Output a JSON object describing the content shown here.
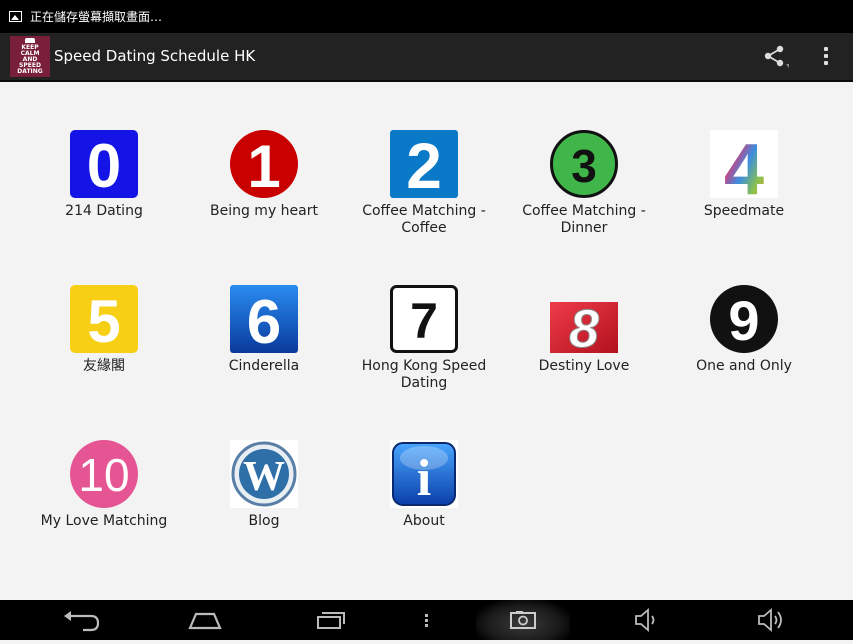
{
  "status_bar": {
    "notification_icon": "image-icon",
    "text": "正在儲存螢幕擷取畫面…"
  },
  "action_bar": {
    "logo_lines": [
      "KEEP",
      "CALM",
      "AND",
      "SPEED",
      "DATING"
    ],
    "title": "Speed Dating Schedule HK",
    "share_icon": "share-icon",
    "overflow_icon": "overflow-menu-icon"
  },
  "grid": {
    "items": [
      {
        "label": "214 Dating",
        "badge": "0",
        "icon": "number-0-icon"
      },
      {
        "label": "Being my heart",
        "badge": "1",
        "icon": "number-1-icon"
      },
      {
        "label": "Coffee Matching - Coffee",
        "badge": "2",
        "icon": "number-2-icon"
      },
      {
        "label": "Coffee Matching - Dinner",
        "badge": "3",
        "icon": "number-3-icon"
      },
      {
        "label": "Speedmate",
        "badge": "4",
        "icon": "number-4-icon"
      },
      {
        "label": "友緣閣",
        "badge": "5",
        "icon": "number-5-icon"
      },
      {
        "label": "Cinderella",
        "badge": "6",
        "icon": "number-6-icon"
      },
      {
        "label": "Hong Kong Speed Dating",
        "badge": "7",
        "icon": "number-7-icon"
      },
      {
        "label": "Destiny Love",
        "badge": "8",
        "icon": "number-8-icon"
      },
      {
        "label": "One and Only",
        "badge": "9",
        "icon": "number-9-icon"
      },
      {
        "label": "My Love Matching",
        "badge": "10",
        "icon": "number-10-icon"
      },
      {
        "label": "Blog",
        "badge": "W",
        "icon": "wordpress-icon"
      },
      {
        "label": "About",
        "badge": "i",
        "icon": "info-icon"
      }
    ]
  },
  "colors": {
    "status_bar": "#000000",
    "action_bar": "#222222",
    "background": "#f3f3f3",
    "navigation_bar": "#000000"
  },
  "nav_bar": {
    "icons": [
      "back-icon",
      "home-icon",
      "recent-apps-icon",
      "menu-icon",
      "screenshot-icon",
      "volume-down-icon",
      "volume-up-icon"
    ]
  }
}
